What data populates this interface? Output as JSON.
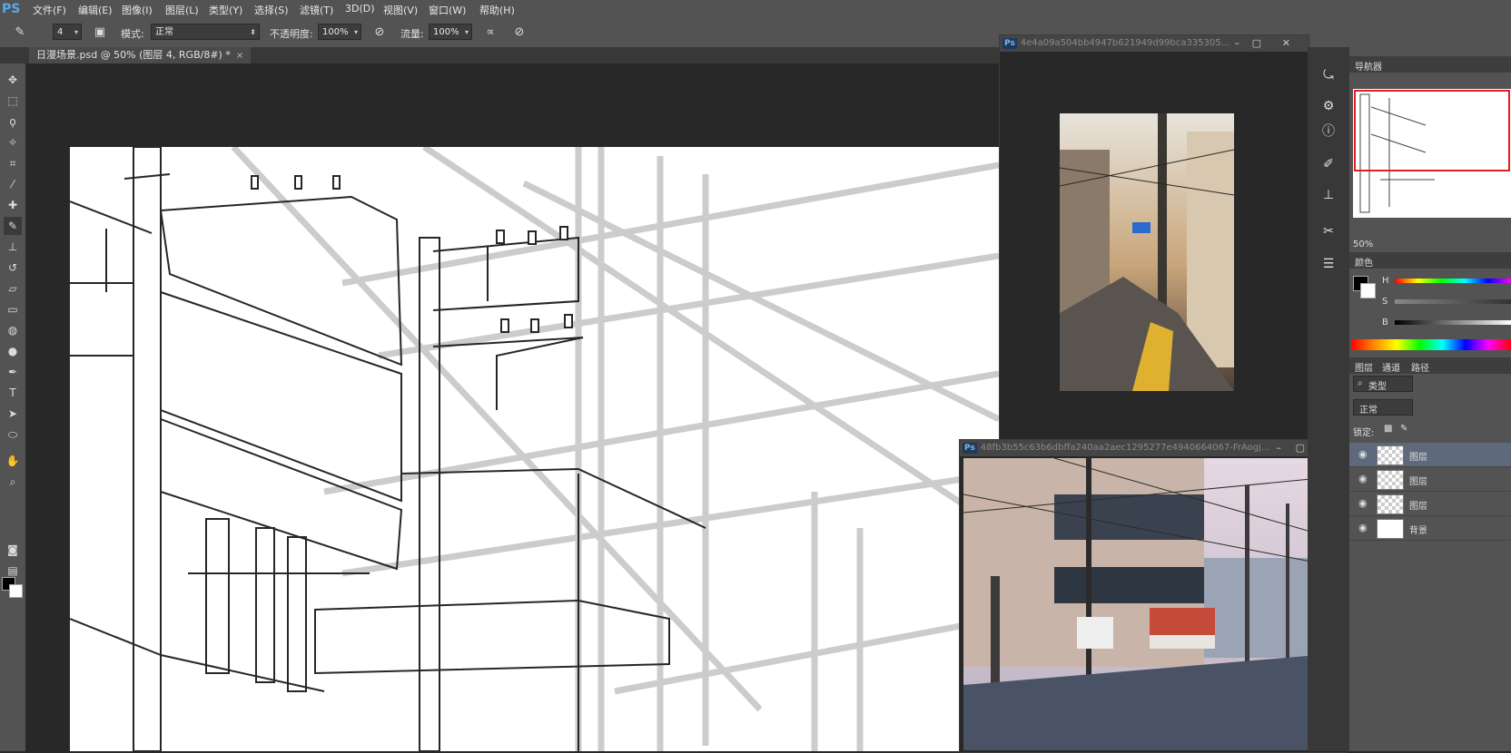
{
  "app": {
    "logo": "PS"
  },
  "menu": [
    "文件(F)",
    "编辑(E)",
    "图像(I)",
    "图层(L)",
    "类型(Y)",
    "选择(S)",
    "滤镜(T)",
    "3D(D)",
    "视图(V)",
    "窗口(W)",
    "帮助(H)"
  ],
  "options": {
    "brush_size": "4",
    "mode_label": "模式:",
    "mode_value": "正常",
    "opacity_label": "不透明度:",
    "opacity_value": "100%",
    "flow_label": "流量:",
    "flow_value": "100%"
  },
  "document_tab": {
    "title": "日漫场景.psd @ 50% (图层 4, RGB/8#) *",
    "close": "×"
  },
  "reference_windows": [
    {
      "title": "4e4a09a504bb4947b621949d99bca335305...",
      "ps": "Ps"
    },
    {
      "title": "48fb3b55c63b6dbffa240aa2aec1295277e4940664067-FrAogj...",
      "ps": "Ps"
    }
  ],
  "window_controls": {
    "min": "–",
    "max": "▢",
    "close": "✕"
  },
  "panels": {
    "navigator_tab": "导航器",
    "zoom": "50%",
    "color_tab": "颜色",
    "hsb": [
      "H",
      "S",
      "B"
    ],
    "layers_tabs": [
      "图层",
      "通道",
      "路径"
    ],
    "filter_kind": "类型",
    "blend_mode": "正常",
    "lock_label": "锁定:",
    "layers": [
      {
        "name": "图层"
      },
      {
        "name": "图层"
      },
      {
        "name": "图层"
      },
      {
        "name": "背景"
      }
    ]
  },
  "colors": {
    "foreground": "#000000",
    "background": "#ffffff",
    "accent": "#5aa8e8"
  }
}
